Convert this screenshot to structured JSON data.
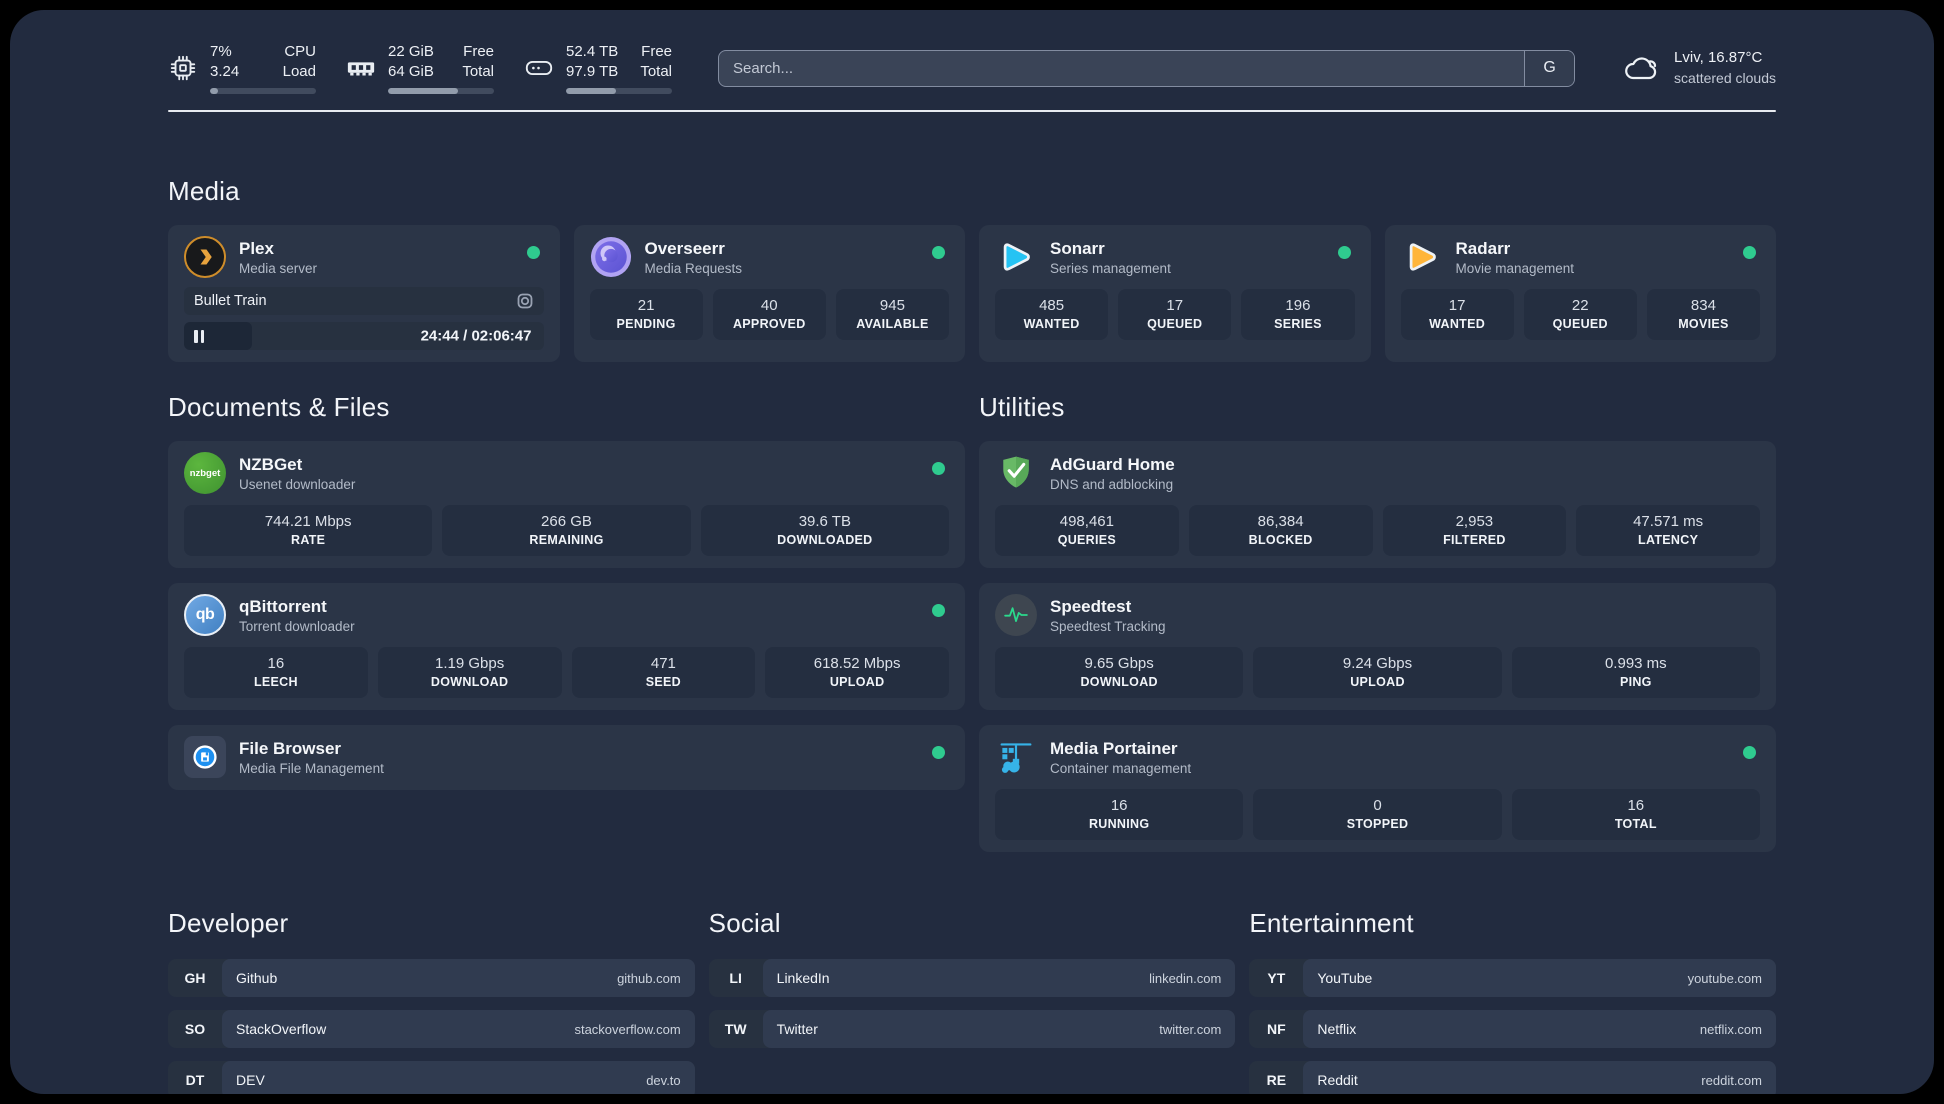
{
  "page": {
    "background": "#222b3f",
    "card_bg": "#2b3547",
    "tile_bg": "#242e40",
    "accent_online": "#2fcb8f"
  },
  "header": {
    "metrics": [
      {
        "icon": "cpu-icon",
        "values": [
          "7%",
          "3.24"
        ],
        "labels": [
          "CPU",
          "Load"
        ],
        "progress_pct": 8
      },
      {
        "icon": "ram-icon",
        "values": [
          "22 GiB",
          "64 GiB"
        ],
        "labels": [
          "Free",
          "Total"
        ],
        "progress_pct": 66
      },
      {
        "icon": "disk-icon",
        "values": [
          "52.4 TB",
          "97.9 TB"
        ],
        "labels": [
          "Free",
          "Total"
        ],
        "progress_pct": 47
      }
    ],
    "search": {
      "placeholder": "Search...",
      "engine_button": "G"
    },
    "weather": {
      "location": "Lviv, 16.87°C",
      "condition": "scattered clouds"
    }
  },
  "sections": {
    "media": {
      "title": "Media",
      "cards": [
        {
          "title": "Plex",
          "subtitle": "Media server",
          "icon": "plex-icon",
          "online": true,
          "player": {
            "track": "Bullet Train",
            "time": "24:44 / 02:06:47",
            "progress_pct": 19
          }
        },
        {
          "title": "Overseerr",
          "subtitle": "Media Requests",
          "icon": "overseerr-icon",
          "online": true,
          "stats": [
            {
              "value": "21",
              "label": "PENDING"
            },
            {
              "value": "40",
              "label": "APPROVED"
            },
            {
              "value": "945",
              "label": "AVAILABLE"
            }
          ]
        },
        {
          "title": "Sonarr",
          "subtitle": "Series management",
          "icon": "sonarr-icon",
          "online": true,
          "stats": [
            {
              "value": "485",
              "label": "WANTED"
            },
            {
              "value": "17",
              "label": "QUEUED"
            },
            {
              "value": "196",
              "label": "SERIES"
            }
          ]
        },
        {
          "title": "Radarr",
          "subtitle": "Movie management",
          "icon": "radarr-icon",
          "online": true,
          "stats": [
            {
              "value": "17",
              "label": "WANTED"
            },
            {
              "value": "22",
              "label": "QUEUED"
            },
            {
              "value": "834",
              "label": "MOVIES"
            }
          ]
        }
      ]
    },
    "documents": {
      "title": "Documents & Files",
      "cards": [
        {
          "title": "NZBGet",
          "subtitle": "Usenet downloader",
          "icon": "nzbget-icon",
          "online": true,
          "stats": [
            {
              "value": "744.21 Mbps",
              "label": "RATE"
            },
            {
              "value": "266 GB",
              "label": "REMAINING"
            },
            {
              "value": "39.6 TB",
              "label": "DOWNLOADED"
            }
          ]
        },
        {
          "title": "qBittorrent",
          "subtitle": "Torrent downloader",
          "icon": "qbittorrent-icon",
          "online": true,
          "stats": [
            {
              "value": "16",
              "label": "LEECH"
            },
            {
              "value": "1.19 Gbps",
              "label": "DOWNLOAD"
            },
            {
              "value": "471",
              "label": "SEED"
            },
            {
              "value": "618.52 Mbps",
              "label": "UPLOAD"
            }
          ]
        },
        {
          "title": "File Browser",
          "subtitle": "Media File Management",
          "icon": "filebrowser-icon",
          "online": true
        }
      ]
    },
    "utilities": {
      "title": "Utilities",
      "cards": [
        {
          "title": "AdGuard Home",
          "subtitle": "DNS and adblocking",
          "icon": "adguard-icon",
          "online": false,
          "stats": [
            {
              "value": "498,461",
              "label": "QUERIES"
            },
            {
              "value": "86,384",
              "label": "BLOCKED"
            },
            {
              "value": "2,953",
              "label": "FILTERED"
            },
            {
              "value": "47.571 ms",
              "label": "LATENCY"
            }
          ]
        },
        {
          "title": "Speedtest",
          "subtitle": "Speedtest Tracking",
          "icon": "speedtest-icon",
          "online": false,
          "stats": [
            {
              "value": "9.65 Gbps",
              "label": "DOWNLOAD"
            },
            {
              "value": "9.24 Gbps",
              "label": "UPLOAD"
            },
            {
              "value": "0.993 ms",
              "label": "PING"
            }
          ]
        },
        {
          "title": "Media Portainer",
          "subtitle": "Container management",
          "icon": "portainer-icon",
          "online": true,
          "stats": [
            {
              "value": "16",
              "label": "RUNNING"
            },
            {
              "value": "0",
              "label": "STOPPED"
            },
            {
              "value": "16",
              "label": "TOTAL"
            }
          ]
        }
      ]
    },
    "bookmarks": [
      {
        "title": "Developer",
        "links": [
          {
            "code": "GH",
            "name": "Github",
            "url": "github.com"
          },
          {
            "code": "SO",
            "name": "StackOverflow",
            "url": "stackoverflow.com"
          },
          {
            "code": "DT",
            "name": "DEV",
            "url": "dev.to"
          }
        ]
      },
      {
        "title": "Social",
        "links": [
          {
            "code": "LI",
            "name": "LinkedIn",
            "url": "linkedin.com"
          },
          {
            "code": "TW",
            "name": "Twitter",
            "url": "twitter.com"
          }
        ]
      },
      {
        "title": "Entertainment",
        "links": [
          {
            "code": "YT",
            "name": "YouTube",
            "url": "youtube.com"
          },
          {
            "code": "NF",
            "name": "Netflix",
            "url": "netflix.com"
          },
          {
            "code": "RE",
            "name": "Reddit",
            "url": "reddit.com"
          }
        ]
      }
    ]
  }
}
